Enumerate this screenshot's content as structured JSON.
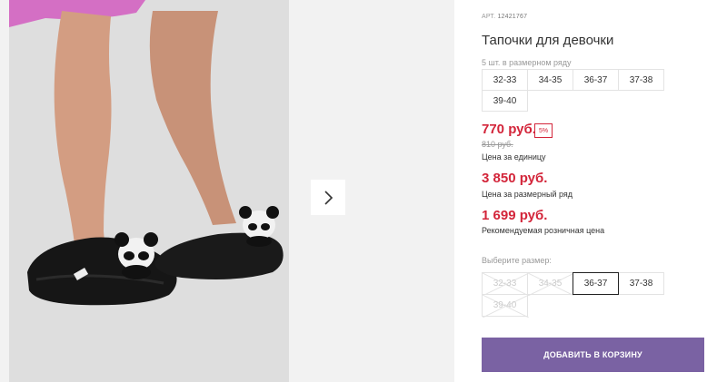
{
  "product": {
    "article_label": "АРТ.",
    "article_value": "12421767",
    "title": "Тапочки для девочки",
    "row_note": "5 шт. в размерном ряду",
    "size_row": [
      "32-33",
      "34-35",
      "36-37",
      "37-38",
      "39-40"
    ],
    "price": "770 руб.",
    "discount": "5%",
    "old_price": "810 руб.",
    "unit_caption": "Цена за единицу",
    "row_price": "3 850 руб.",
    "row_caption": "Цена за размерный ряд",
    "retail_price": "1 699 руб.",
    "retail_caption": "Рекомендуемая розничная цена"
  },
  "size_selector": {
    "label": "Выберите размер:",
    "options": [
      {
        "label": "32-33",
        "state": "unavailable"
      },
      {
        "label": "34-35",
        "state": "unavailable"
      },
      {
        "label": "36-37",
        "state": "selected"
      },
      {
        "label": "37-38",
        "state": "available"
      },
      {
        "label": "39-40",
        "state": "unavailable"
      }
    ]
  },
  "cart": {
    "add_label": "ДОБАВИТЬ В КОРЗИНУ"
  },
  "gallery": {
    "next_icon": "chevron-right-icon"
  },
  "colors": {
    "price_red": "#d3253a",
    "button_purple": "#7a62a3",
    "selected_border": "#222222"
  }
}
